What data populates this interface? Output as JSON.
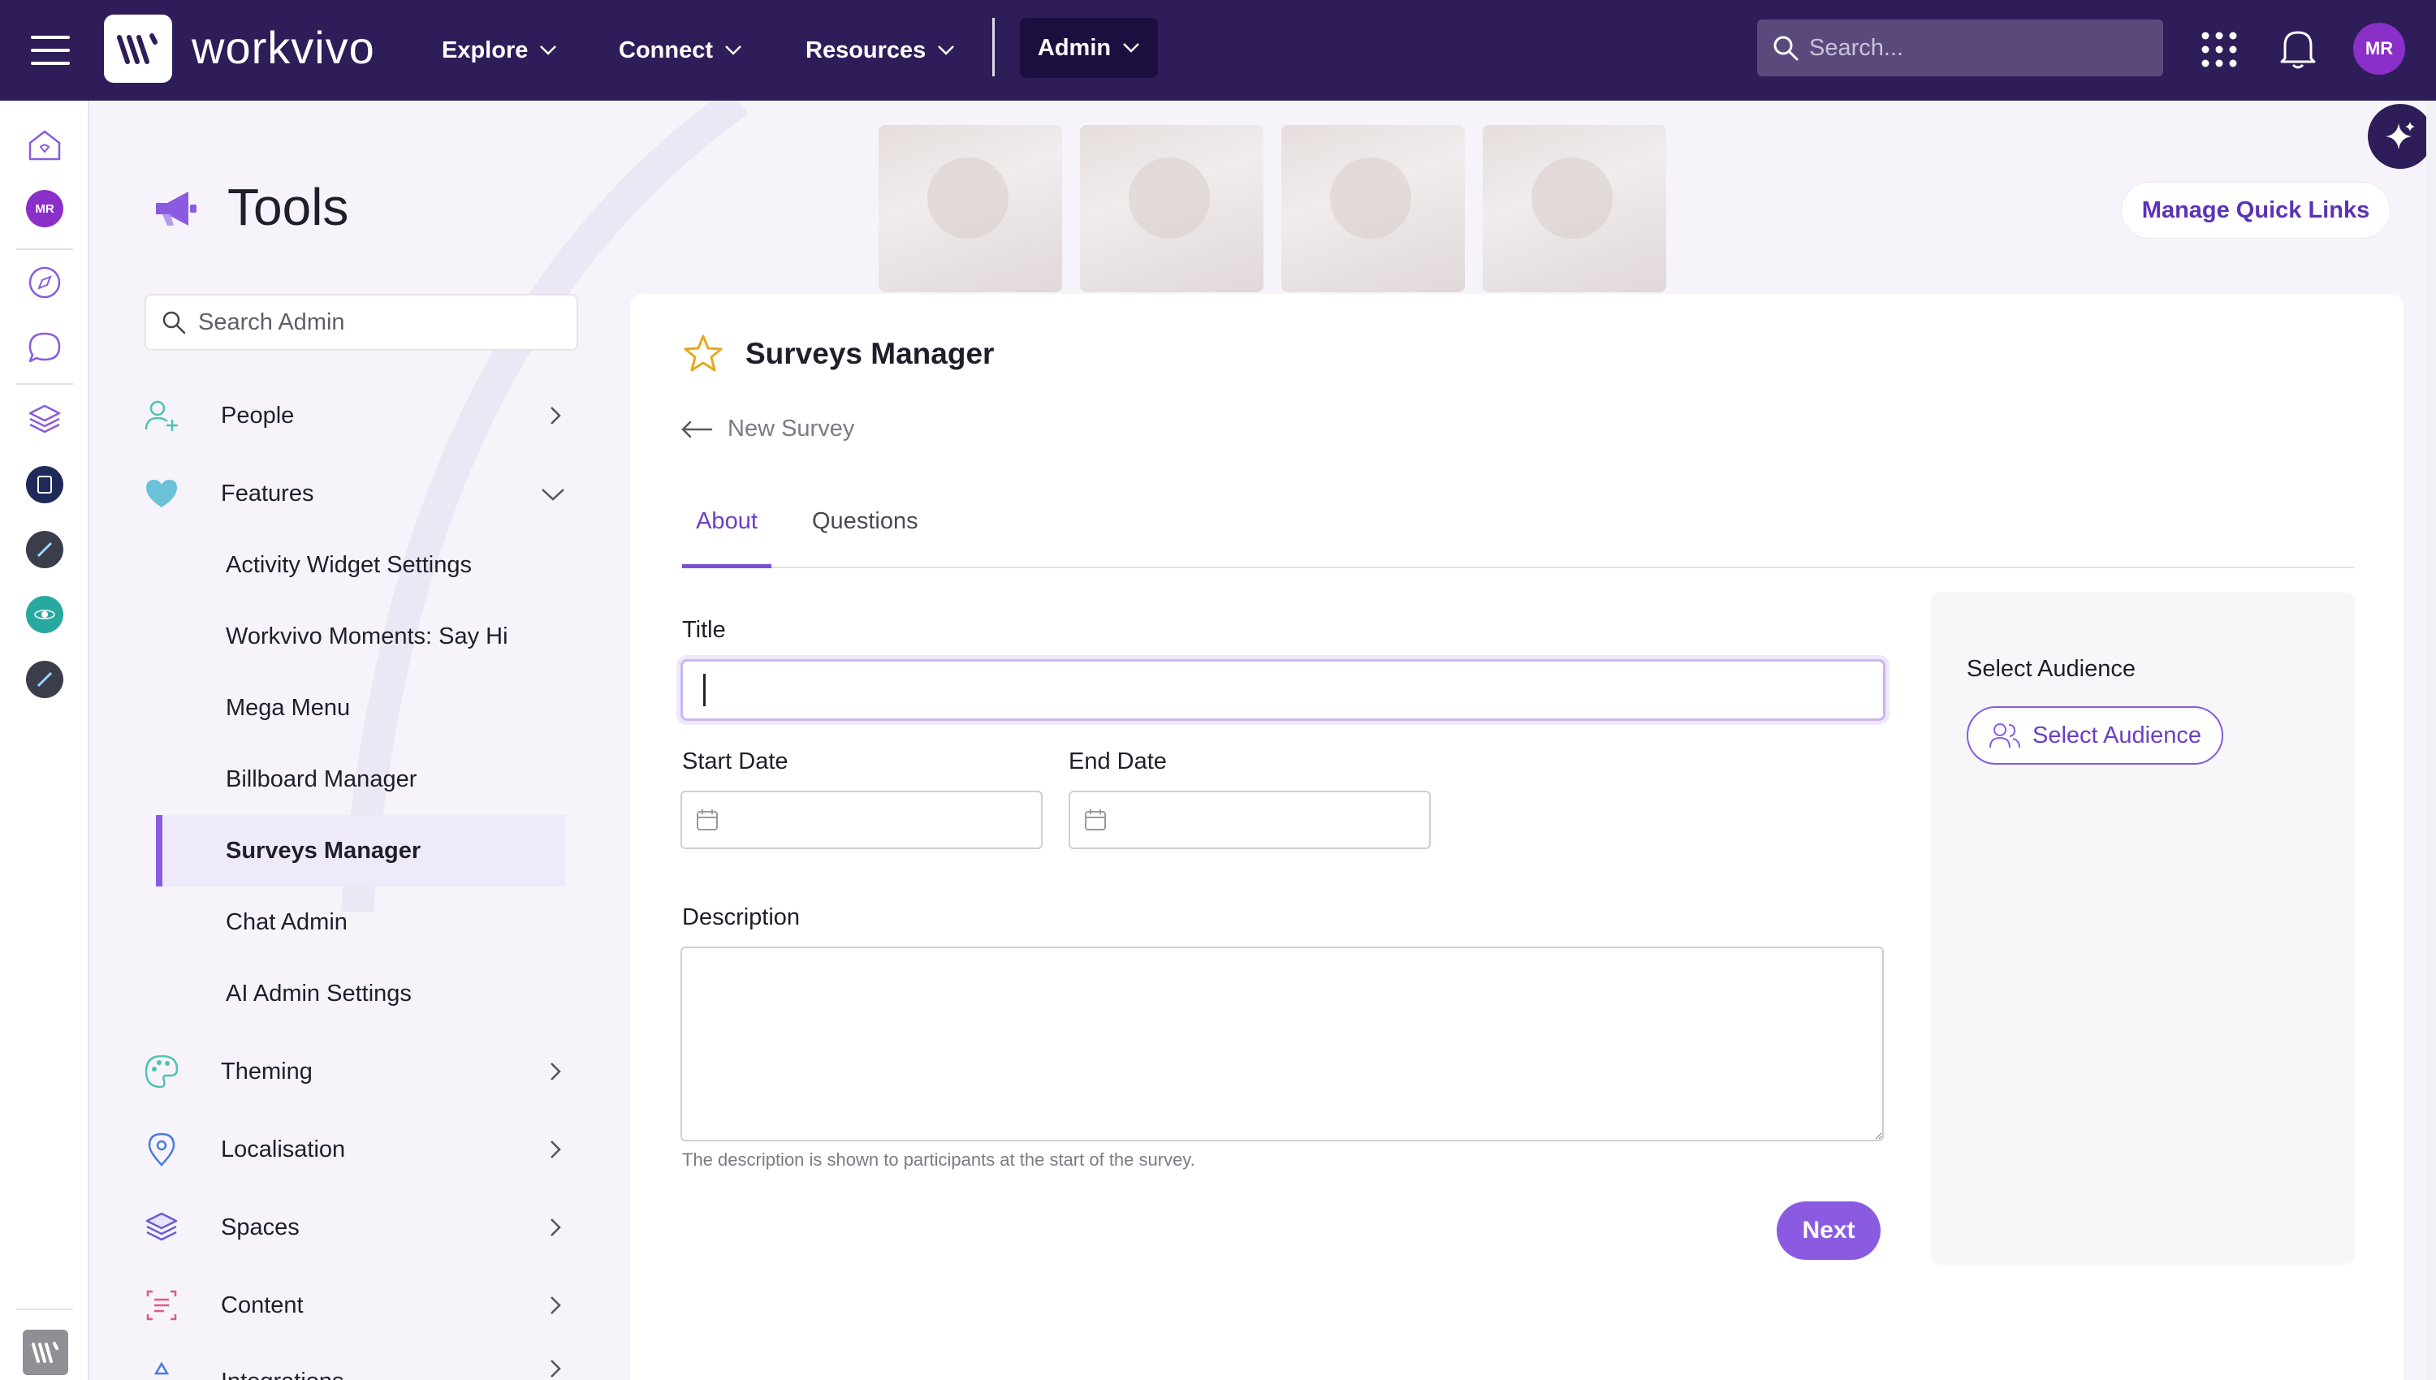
{
  "topbar": {
    "logo_text": "workvivo",
    "nav": [
      {
        "label": "Explore"
      },
      {
        "label": "Connect"
      },
      {
        "label": "Resources"
      }
    ],
    "admin_label": "Admin",
    "search_placeholder": "Search...",
    "avatar_initials": "MR"
  },
  "rail": {
    "avatar_initials": "MR"
  },
  "page": {
    "title": "Tools",
    "quick_links_label": "Manage Quick Links"
  },
  "sidebar": {
    "search_placeholder": "Search Admin",
    "sections": {
      "people": "People",
      "features": "Features",
      "theming": "Theming",
      "localisation": "Localisation",
      "spaces": "Spaces",
      "content": "Content",
      "integrations": "Integrations"
    },
    "feature_items": [
      {
        "label": "Activity Widget Settings"
      },
      {
        "label": "Workvivo Moments: Say Hi"
      },
      {
        "label": "Mega Menu"
      },
      {
        "label": "Billboard Manager"
      },
      {
        "label": "Surveys Manager",
        "active": true
      },
      {
        "label": "Chat Admin"
      },
      {
        "label": "AI Admin Settings"
      }
    ]
  },
  "survey": {
    "title": "Surveys Manager",
    "back_label": "New Survey",
    "tabs": [
      "About",
      "Questions"
    ],
    "active_tab": "About",
    "title_label": "Title",
    "title_value": "",
    "start_date_label": "Start Date",
    "end_date_label": "End Date",
    "description_label": "Description",
    "description_help": "The description is shown to participants at the start of the survey.",
    "next_label": "Next"
  },
  "audience": {
    "label": "Select Audience",
    "button_label": "Select Audience"
  },
  "colors": {
    "topbar": "#2f1d59",
    "accent": "#8a5be0",
    "active_bg": "#efeaf9"
  }
}
